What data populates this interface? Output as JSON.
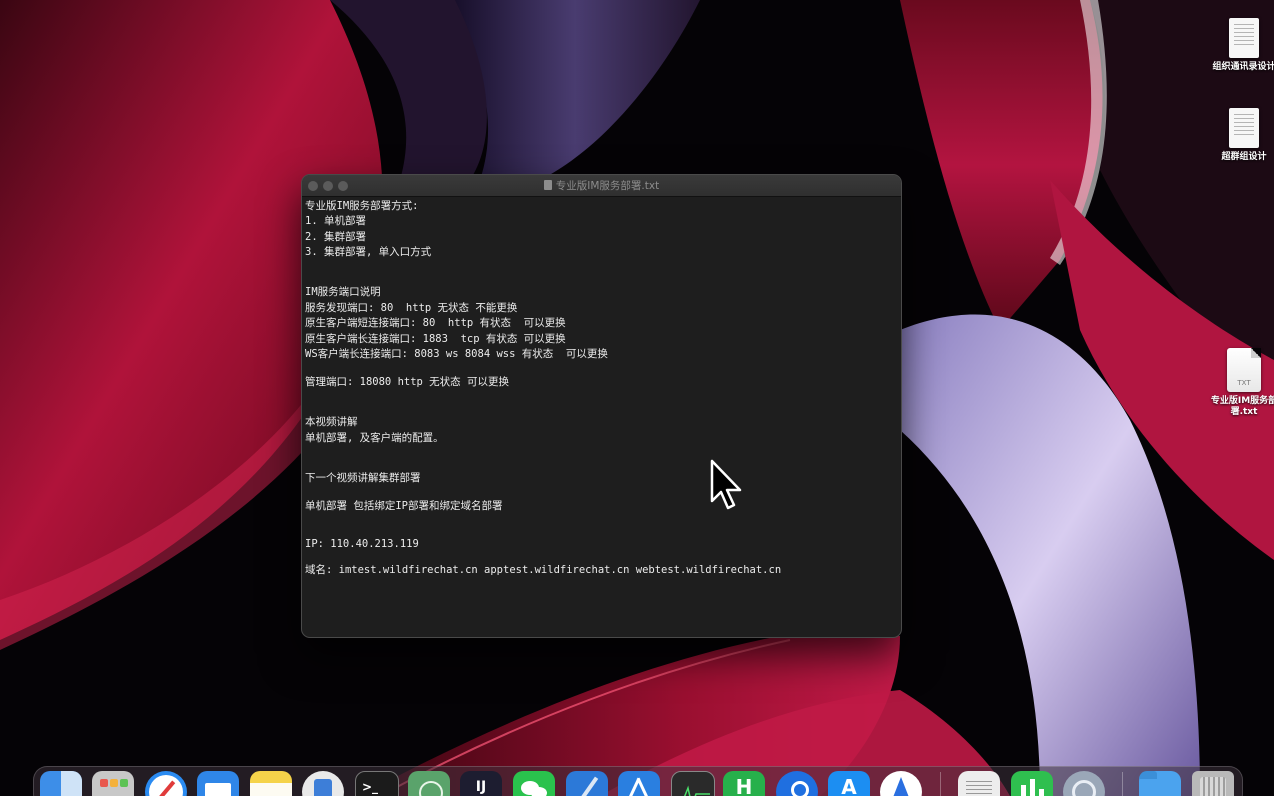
{
  "desktop": {
    "icons": [
      {
        "label": "组织通讯录设计"
      },
      {
        "label": "超群组设计"
      },
      {
        "label_line1": "专业版IM服务部",
        "label_line2": "署.txt",
        "ext": "TXT"
      }
    ]
  },
  "window": {
    "title": "专业版IM服务部署.txt",
    "lines": [
      "专业版IM服务部署方式:",
      "1. 单机部署",
      "2. 集群部署",
      "3. 集群部署, 单入口方式",
      "IM服务端口说明",
      "服务发现端口: 80  http 无状态 不能更换",
      "原生客户端短连接端口: 80  http 有状态  可以更换",
      "原生客户端长连接端口: 1883  tcp 有状态 可以更换",
      "WS客户端长连接端口: 8083 ws 8084 wss 有状态  可以更换",
      "管理端口: 18080 http 无状态 可以更换",
      "本视频讲解",
      "单机部署, 及客户端的配置。",
      "下一个视频讲解集群部署",
      "单机部署 包括绑定IP部署和绑定域名部署",
      "IP: 110.40.213.119",
      "域名: imtest.wildfirechat.cn apptest.wildfirechat.cn webtest.wildfirechat.cn"
    ]
  },
  "dock": {
    "items": [
      {
        "name": "finder",
        "glyph": "",
        "color": "#3d8ee8"
      },
      {
        "name": "launchpad",
        "glyph": "",
        "color": "#c8c8c8"
      },
      {
        "name": "safari",
        "glyph": "",
        "color": "#2a8bf2"
      },
      {
        "name": "mail",
        "glyph": "",
        "color": "#2f86e8"
      },
      {
        "name": "notes",
        "glyph": "",
        "color": "#f5d34a"
      },
      {
        "name": "preview",
        "glyph": "",
        "color": "#e9e9e9"
      },
      {
        "name": "terminal",
        "glyph": ">_",
        "color": "#1b1b1b"
      },
      {
        "name": "atom",
        "glyph": "",
        "color": "#5aa36b"
      },
      {
        "name": "intellij-idea",
        "glyph": "IJ",
        "color": "#1d1d30"
      },
      {
        "name": "wechat",
        "glyph": "",
        "color": "#2ac24d"
      },
      {
        "name": "xcode",
        "glyph": "",
        "color": "#2c79d8"
      },
      {
        "name": "app-developer",
        "glyph": "",
        "color": "#2a7fe0"
      },
      {
        "name": "activity-monitor",
        "glyph": "",
        "color": "#2a2a2a"
      },
      {
        "name": "hbuilder",
        "glyph": "H",
        "color": "#27b04b"
      },
      {
        "name": "location-app",
        "glyph": "",
        "color": "#1f6fe0"
      },
      {
        "name": "app-store",
        "glyph": "A",
        "color": "#1c8ef2"
      },
      {
        "name": "direct-app",
        "glyph": "",
        "color": "#ffffff"
      },
      {
        "name": "textedit",
        "glyph": "",
        "color": "#ededed"
      },
      {
        "name": "numbers",
        "glyph": "",
        "color": "#2fbf4f"
      },
      {
        "name": "quicktime",
        "glyph": "",
        "color": "#9aa7b8"
      },
      {
        "name": "downloads-folder",
        "glyph": "",
        "color": "#4ba3ee"
      },
      {
        "name": "trash",
        "glyph": "",
        "color": "#b9b9b9"
      }
    ]
  }
}
